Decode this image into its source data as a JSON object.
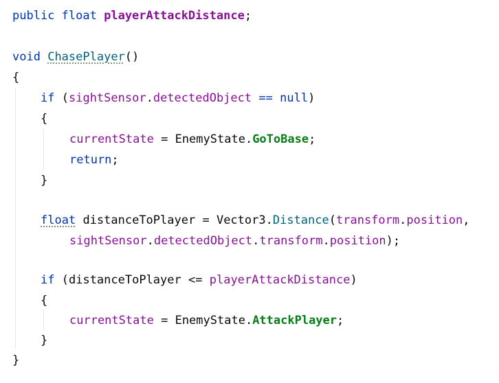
{
  "code": {
    "l1": {
      "public_kw": "public",
      "type_kw": "float",
      "field_name": "playerAttackDistance",
      "semicolon": ";"
    },
    "l2": {
      "void_kw": "void",
      "method_name": "ChasePlayer",
      "parens": "()"
    },
    "l3": {
      "open_brace": "{"
    },
    "l4": {
      "if_kw": "if",
      "open_paren": "(",
      "sensor": "sightSensor",
      "dot": ".",
      "detected": "detectedObject",
      "op": "==",
      "null_kw": "null",
      "close_paren": ")"
    },
    "l5": {
      "open_brace": "{"
    },
    "l6": {
      "current_state": "currentState",
      "assign": "=",
      "enum_type": "EnemyState",
      "dot": ".",
      "enum_value": "GoToBase",
      "semicolon": ";"
    },
    "l7": {
      "return_kw": "return",
      "semicolon": ";"
    },
    "l8": {
      "close_brace": "}"
    },
    "l9": {
      "type_kw": "float",
      "var_name": "distanceToPlayer",
      "assign": "=",
      "class_name": "Vector3",
      "dot": ".",
      "method": "Distance",
      "open_paren": "(",
      "transform": "transform",
      "dot2": ".",
      "position": "position",
      "comma": ","
    },
    "l10": {
      "sensor": "sightSensor",
      "dot": ".",
      "detected": "detectedObject",
      "dot2": ".",
      "transform": "transform",
      "dot3": ".",
      "position": "position",
      "close": ");"
    },
    "l11": {
      "if_kw": "if",
      "open_paren": "(",
      "var_name": "distanceToPlayer",
      "op": "<=",
      "field_name": "playerAttackDistance",
      "close_paren": ")"
    },
    "l12": {
      "open_brace": "{"
    },
    "l13": {
      "current_state": "currentState",
      "assign": "=",
      "enum_type": "EnemyState",
      "dot": ".",
      "enum_value": "AttackPlayer",
      "semicolon": ";"
    },
    "l14": {
      "close_brace": "}"
    },
    "l15": {
      "close_brace": "}"
    }
  },
  "colors": {
    "keyword": "#0033b3",
    "field": "#871094",
    "method": "#00627a",
    "member": "#067d17",
    "plain": "#080808",
    "background": "#ffffff"
  }
}
